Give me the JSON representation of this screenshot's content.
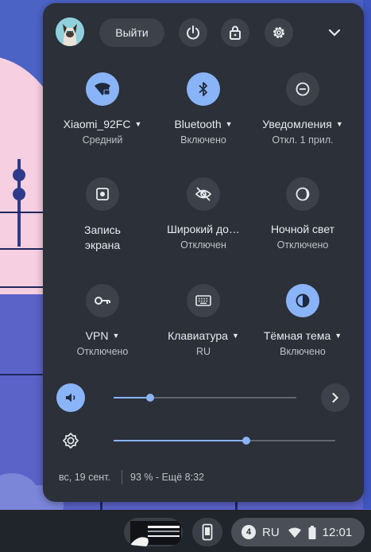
{
  "header": {
    "signout_label": "Выйти",
    "icons": [
      "avatar",
      "power-icon",
      "lock-icon",
      "gear-icon",
      "chevron-down-icon"
    ]
  },
  "tiles": [
    {
      "label": "Xiaomi_92FC",
      "sub": "Средний",
      "icon": "wifi-icon",
      "on": true,
      "caret": true
    },
    {
      "label": "Bluetooth",
      "sub": "Включено",
      "icon": "bluetooth-icon",
      "on": true,
      "caret": true
    },
    {
      "label": "Уведомления",
      "sub": "Откл. 1 прил.",
      "icon": "do-not-disturb-icon",
      "on": false,
      "caret": true
    },
    {
      "label": "Запись экрана",
      "sub": "",
      "icon": "screen-capture-icon",
      "on": false,
      "caret": false
    },
    {
      "label": "Широкий до…",
      "sub": "Отключен",
      "icon": "visibility-off-icon",
      "on": false,
      "caret": false
    },
    {
      "label": "Ночной свет",
      "sub": "Отключено",
      "icon": "night-light-icon",
      "on": false,
      "caret": false
    },
    {
      "label": "VPN",
      "sub": "Отключено",
      "icon": "vpn-key-icon",
      "on": false,
      "caret": true
    },
    {
      "label": "Клавиатура",
      "sub": "RU",
      "icon": "keyboard-icon",
      "on": false,
      "caret": true
    },
    {
      "label": "Тёмная тема",
      "sub": "Включено",
      "icon": "dark-theme-icon",
      "on": true,
      "caret": true
    }
  ],
  "sliders": {
    "volume": {
      "level": 0.2,
      "icon": "volume-icon"
    },
    "brightness": {
      "level": 0.6,
      "icon": "brightness-icon"
    }
  },
  "footer": {
    "date": "вс, 19 сент.",
    "battery": "93 % - Ещё 8:32"
  },
  "shelf": {
    "notification_count": "4",
    "language": "RU",
    "time": "12:01"
  },
  "colors": {
    "panel": "#2b3039",
    "accent": "#8ab4f8",
    "button": "#3c414a",
    "shelf": "#20252b"
  }
}
